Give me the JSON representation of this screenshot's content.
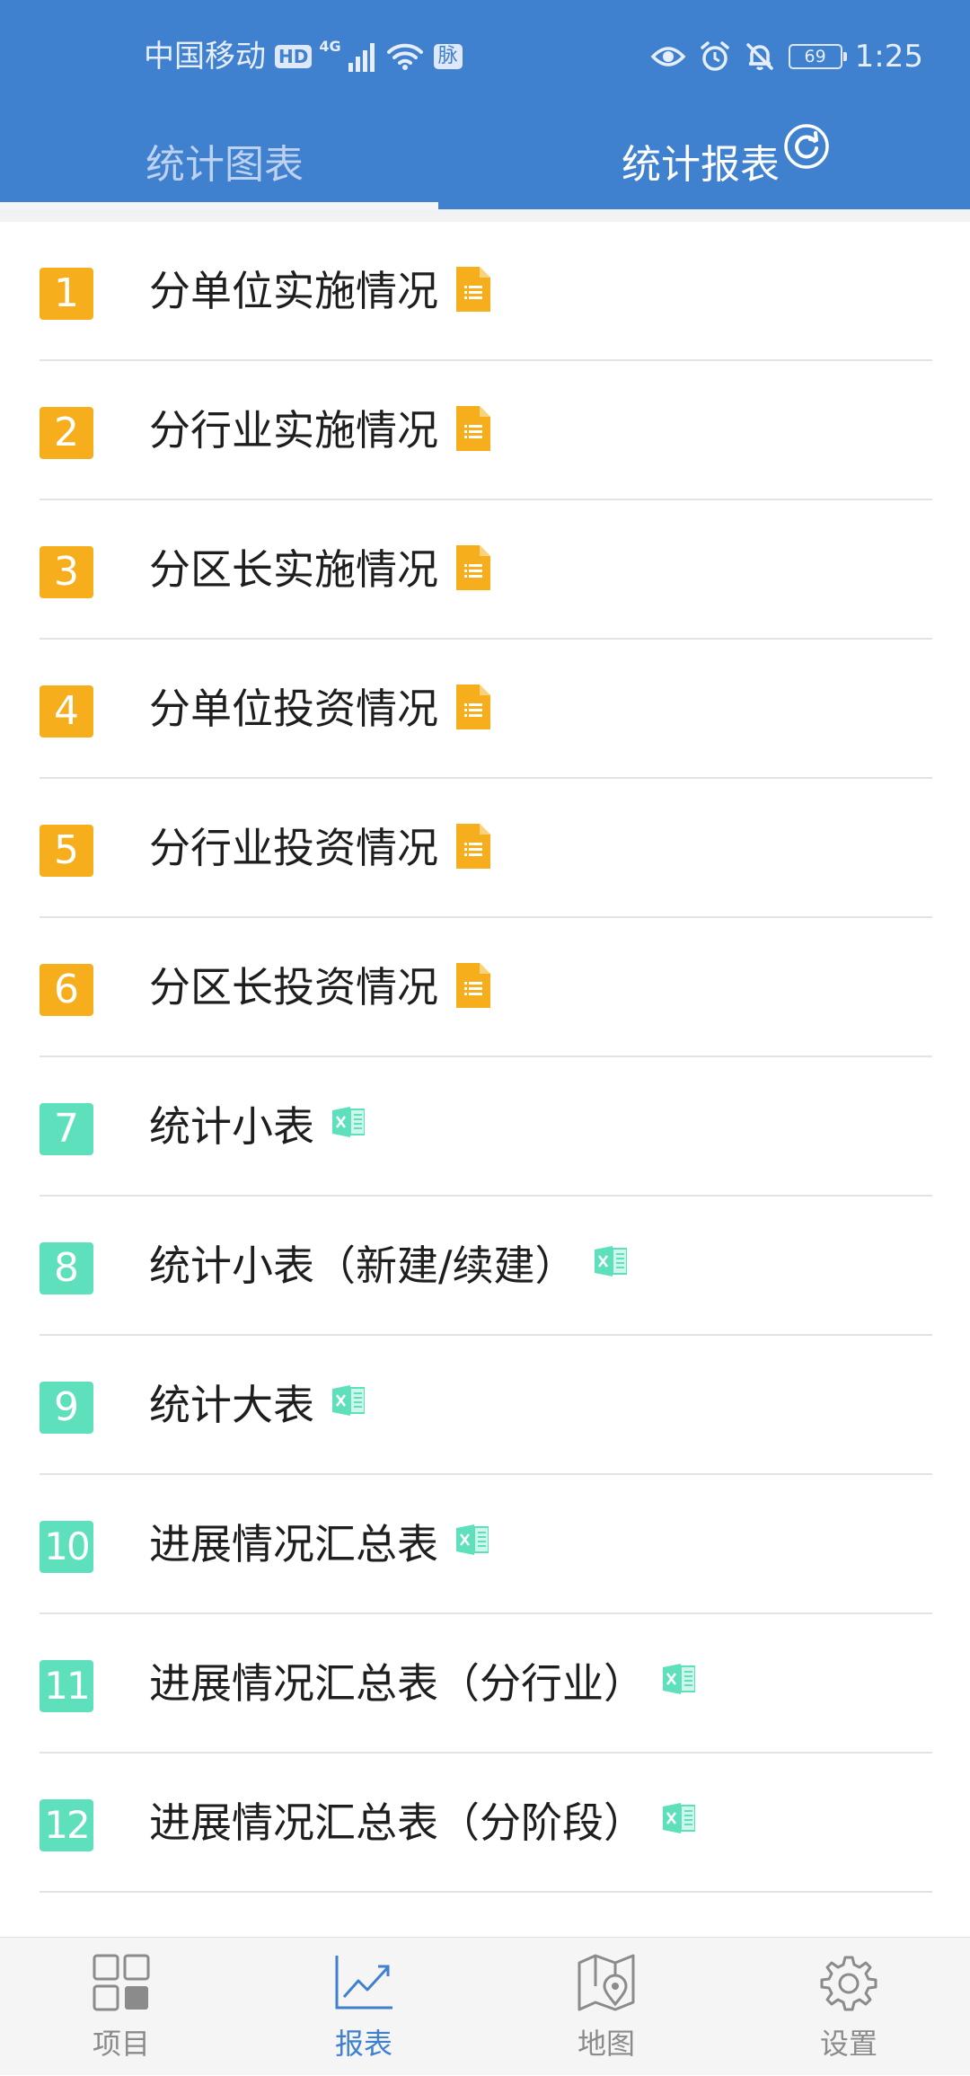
{
  "status_bar": {
    "carrier": "中国移动",
    "hd_badge": "HD",
    "network_type": "4G",
    "app_badge": "脉",
    "battery_level": "69",
    "time": "1:25"
  },
  "tabs": [
    {
      "label": "统计图表",
      "active": false
    },
    {
      "label": "统计报表",
      "active": true
    }
  ],
  "reports": [
    {
      "number": "1",
      "label": "分单位实施情况",
      "icon": "document-icon",
      "badge_color": "#f7ae1c"
    },
    {
      "number": "2",
      "label": "分行业实施情况",
      "icon": "document-icon",
      "badge_color": "#f7ae1c"
    },
    {
      "number": "3",
      "label": "分区长实施情况",
      "icon": "document-icon",
      "badge_color": "#f7ae1c"
    },
    {
      "number": "4",
      "label": "分单位投资情况",
      "icon": "document-icon",
      "badge_color": "#f7ae1c"
    },
    {
      "number": "5",
      "label": "分行业投资情况",
      "icon": "document-icon",
      "badge_color": "#f7ae1c"
    },
    {
      "number": "6",
      "label": "分区长投资情况",
      "icon": "document-icon",
      "badge_color": "#f7ae1c"
    },
    {
      "number": "7",
      "label": "统计小表",
      "icon": "excel-icon",
      "badge_color": "#5fe0bd"
    },
    {
      "number": "8",
      "label": "统计小表（新建/续建）",
      "icon": "excel-icon",
      "badge_color": "#5fe0bd"
    },
    {
      "number": "9",
      "label": "统计大表",
      "icon": "excel-icon",
      "badge_color": "#5fe0bd"
    },
    {
      "number": "10",
      "label": "进展情况汇总表",
      "icon": "excel-icon",
      "badge_color": "#5fe0bd"
    },
    {
      "number": "11",
      "label": "进展情况汇总表（分行业）",
      "icon": "excel-icon",
      "badge_color": "#5fe0bd"
    },
    {
      "number": "12",
      "label": "进展情况汇总表（分阶段）",
      "icon": "excel-icon",
      "badge_color": "#5fe0bd"
    }
  ],
  "bottom_nav": [
    {
      "label": "项目",
      "icon": "grid-icon",
      "active": false
    },
    {
      "label": "报表",
      "icon": "trend-chart-icon",
      "active": true
    },
    {
      "label": "地图",
      "icon": "map-pin-icon",
      "active": false
    },
    {
      "label": "设置",
      "icon": "gear-icon",
      "active": false
    }
  ],
  "colors": {
    "primary": "#3f80cf",
    "document_badge": "#f7ae1c",
    "excel_badge": "#5fe0bd",
    "nav_inactive": "#8b8b8b"
  }
}
